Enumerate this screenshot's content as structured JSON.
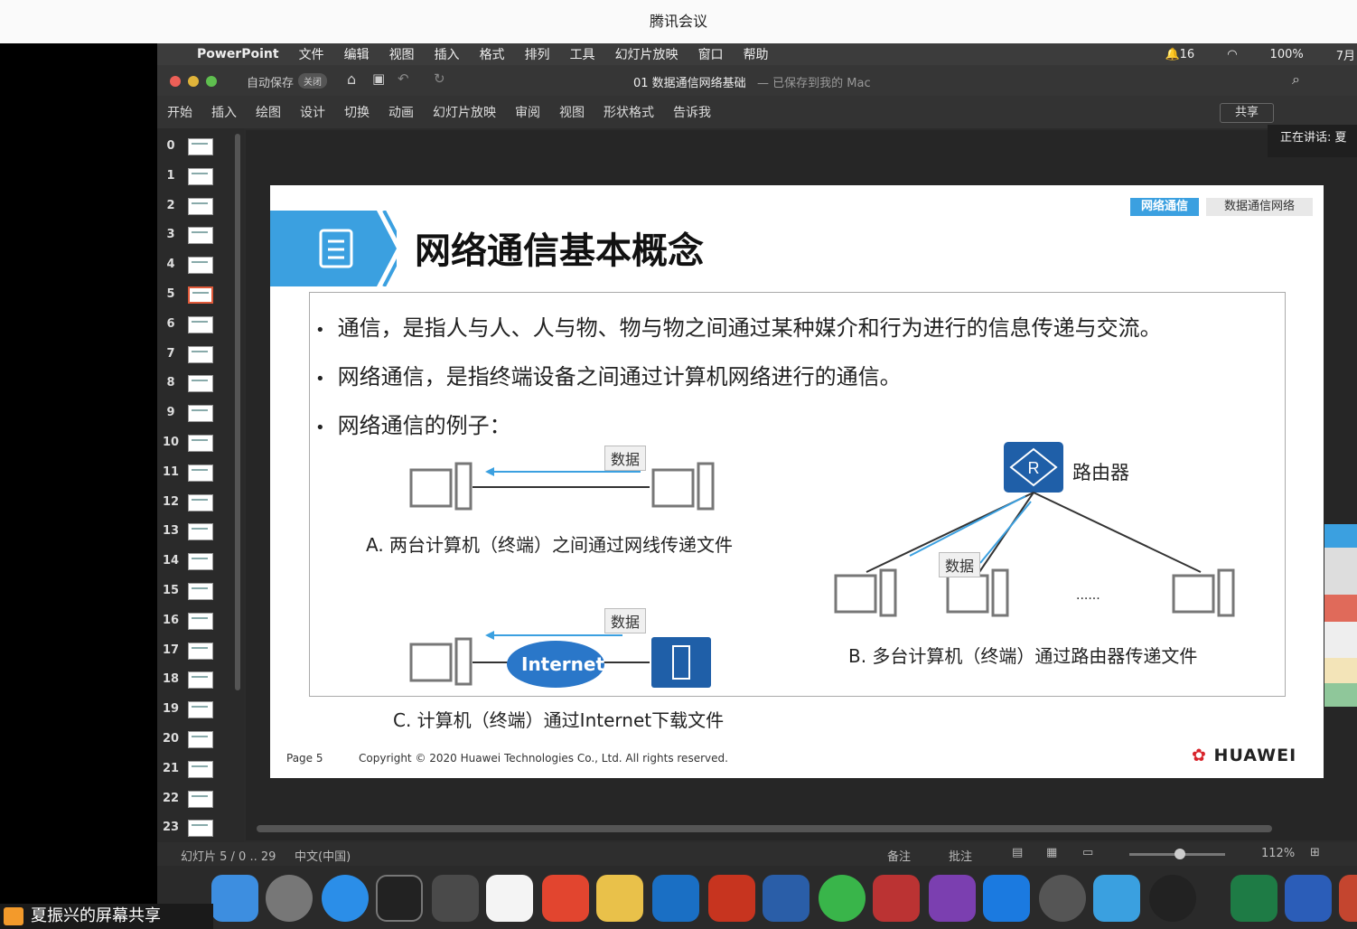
{
  "meeting": {
    "title": "腾讯会议",
    "sharer": "夏振兴的屏幕共享",
    "speaking": "正在讲话: 夏"
  },
  "menubar": {
    "app": "PowerPoint",
    "items": [
      "文件",
      "编辑",
      "视图",
      "插入",
      "格式",
      "排列",
      "工具",
      "幻灯片放映",
      "窗口",
      "帮助"
    ],
    "status": {
      "notifications": "16",
      "battery": "100%",
      "clock": "7月"
    }
  },
  "titlebar": {
    "autosave_label": "自动保存",
    "autosave_state": "关闭",
    "doc_title": "01 数据通信网络基础",
    "save_state": "— 已保存到我的 Mac"
  },
  "ribbon": {
    "tabs": [
      "开始",
      "插入",
      "绘图",
      "设计",
      "切换",
      "动画",
      "幻灯片放映",
      "审阅",
      "视图",
      "形状格式",
      "告诉我"
    ],
    "share": "共享"
  },
  "thumbnails": {
    "numbers": [
      "0",
      "1",
      "2",
      "3",
      "4",
      "5",
      "6",
      "7",
      "8",
      "9",
      "10",
      "11",
      "12",
      "13",
      "14",
      "15",
      "16",
      "17",
      "18",
      "19",
      "20",
      "21",
      "22",
      "23"
    ],
    "selected": "5"
  },
  "slide": {
    "title": "网络通信基本概念",
    "breadcrumb": [
      "网络通信",
      "数据通信网络"
    ],
    "bullets": [
      "通信，是指人与人、人与物、物与物之间通过某种媒介和行为进行的信息传递与交流。",
      "网络通信，是指终端设备之间通过计算机网络进行的通信。",
      "网络通信的例子："
    ],
    "data_label": "数据",
    "router_label": "路由器",
    "internet_label": "Internet",
    "ellipsis": "......",
    "caption_a": "A. 两台计算机（终端）之间通过网线传递文件",
    "caption_b": "B. 多台计算机（终端）通过路由器传递文件",
    "caption_c": "C. 计算机（终端）通过Internet下载文件",
    "page": "Page 5",
    "copyright": "Copyright © 2020 Huawei Technologies Co., Ltd. All rights reserved.",
    "logo": "HUAWEI"
  },
  "statusbar": {
    "slide_info": "幻灯片 5 / 0 .. 29",
    "language": "中文(中国)",
    "notes": "备注",
    "comments": "批注",
    "zoom": "112%"
  },
  "colors": {
    "accent": "#3ba0e0",
    "router": "#1f5fa8",
    "selected_thumb": "#e05a3a"
  }
}
